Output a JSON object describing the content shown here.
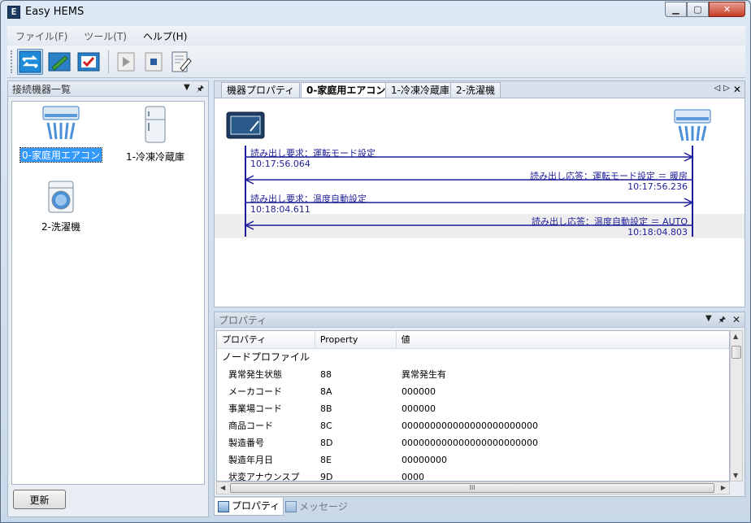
{
  "window": {
    "title": "Easy HEMS",
    "app_icon_glyph": "E"
  },
  "menu": [
    "ファイル(F)",
    "ツール(T)",
    "ヘルプ(H)"
  ],
  "toolbar": {
    "buttons": [
      {
        "name": "connect-icon",
        "active": true
      },
      {
        "name": "edit-icon",
        "active": false
      },
      {
        "name": "check-icon",
        "active": false
      },
      {
        "name": "play-icon",
        "active": false
      },
      {
        "name": "stop-icon",
        "active": false
      },
      {
        "name": "clear-icon",
        "active": false
      }
    ]
  },
  "left_panel": {
    "title": "接続機器一覧",
    "devices": [
      {
        "label": "0-家庭用エアコン",
        "icon": "air-conditioner-icon",
        "selected": true
      },
      {
        "label": "1-冷凍冷蔵庫",
        "icon": "refrigerator-icon",
        "selected": false
      },
      {
        "label": "2-洗濯機",
        "icon": "washing-machine-icon",
        "selected": false
      }
    ],
    "refresh_label": "更新"
  },
  "tabs": [
    {
      "label": "機器プロパティ",
      "active": false
    },
    {
      "label": "0-家庭用エアコン",
      "active": true
    },
    {
      "label": "1-冷凍冷蔵庫",
      "active": false
    },
    {
      "label": "2-洗濯機",
      "active": false
    }
  ],
  "sequence": [
    {
      "direction": "request",
      "text": "読み出し要求：運転モード設定",
      "time": "10:17:56.064"
    },
    {
      "direction": "response",
      "text": "読み出し応答：運転モード設定 ＝ 暖房",
      "time": "10:17:56.236"
    },
    {
      "direction": "request",
      "text": "読み出し要求：温度自動設定",
      "time": "10:18:04.611"
    },
    {
      "direction": "response",
      "text": "読み出し応答：温度自動設定 ＝ AUTO",
      "time": "10:18:04.803"
    }
  ],
  "property_panel": {
    "title": "プロパティ",
    "columns": [
      "プロパティ",
      "Property",
      "値"
    ],
    "group": "ノードプロファイル",
    "rows": [
      [
        "異常発生状態",
        "88",
        "異常発生有"
      ],
      [
        "メーカコード",
        "8A",
        "000000"
      ],
      [
        "事業場コード",
        "8B",
        "000000"
      ],
      [
        "商品コード",
        "8C",
        "000000000000000000000000"
      ],
      [
        "製造番号",
        "8D",
        "000000000000000000000000"
      ],
      [
        "製造年月日",
        "8E",
        "00000000"
      ],
      [
        "状変アナウンスプ",
        "9D",
        "0000"
      ]
    ],
    "hscroll_glyph": "III"
  },
  "bottom_tabs": [
    {
      "label": "プロパティ",
      "active": true
    },
    {
      "label": "メッセージ",
      "active": false
    }
  ],
  "colors": {
    "arrow": "#1c1c9a",
    "selection": "#3399ff",
    "close_button": "#c43b25"
  }
}
